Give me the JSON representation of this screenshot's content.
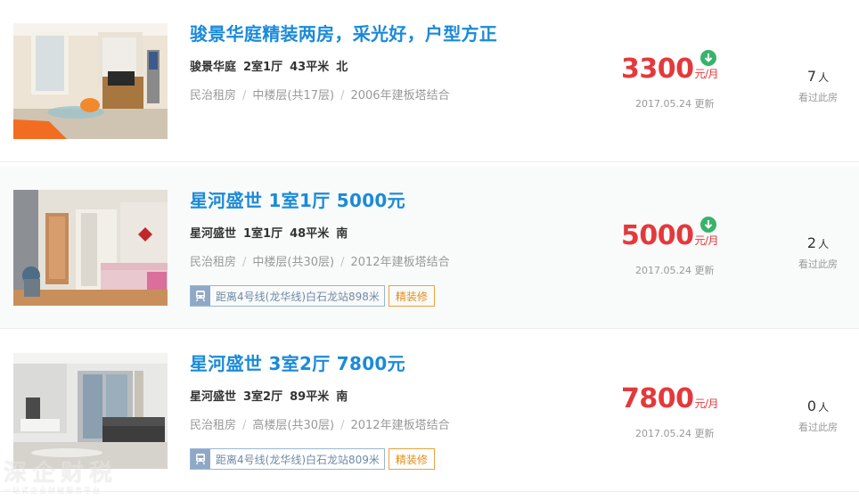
{
  "listings": [
    {
      "title": "骏景华庭精装两房，采光好，户型方正",
      "community": "骏景华庭",
      "layout": "2室1厅",
      "area": "43平米",
      "orientation": "北",
      "district": "民治租房",
      "floor": "中楼层(共17层)",
      "build": "2006年建板塔结合",
      "price": "3300",
      "price_unit": "元/月",
      "price_down": true,
      "updated": "2017.05.24 更新",
      "views_count": "7",
      "views_unit": "人",
      "views_label": "看过此房",
      "subway": "",
      "decoration": ""
    },
    {
      "title": "星河盛世 1室1厅 5000元",
      "community": "星河盛世",
      "layout": "1室1厅",
      "area": "48平米",
      "orientation": "南",
      "district": "民治租房",
      "floor": "中楼层(共30层)",
      "build": "2012年建板塔结合",
      "price": "5000",
      "price_unit": "元/月",
      "price_down": true,
      "updated": "2017.05.24 更新",
      "views_count": "2",
      "views_unit": "人",
      "views_label": "看过此房",
      "subway": "距离4号线(龙华线)白石龙站898米",
      "decoration": "精装修"
    },
    {
      "title": "星河盛世 3室2厅 7800元",
      "community": "星河盛世",
      "layout": "3室2厅",
      "area": "89平米",
      "orientation": "南",
      "district": "民治租房",
      "floor": "高楼层(共30层)",
      "build": "2012年建板塔结合",
      "price": "7800",
      "price_unit": "元/月",
      "price_down": false,
      "updated": "2017.05.24 更新",
      "views_count": "0",
      "views_unit": "人",
      "views_label": "看过此房",
      "subway": "距离4号线(龙华线)白石龙站809米",
      "decoration": "精装修"
    }
  ],
  "icons": {
    "price_down": "arrow-down-icon",
    "subway": "subway-icon"
  },
  "colors": {
    "title": "#1b8ad9",
    "price": "#e4393c",
    "price_down_badge": "#38b36b",
    "decoration_tag": "#e58d16",
    "subway_tag": "#6f8aa8"
  },
  "watermark": {
    "text": "深企财税",
    "subtext": "一站式企业财税服务平台"
  }
}
